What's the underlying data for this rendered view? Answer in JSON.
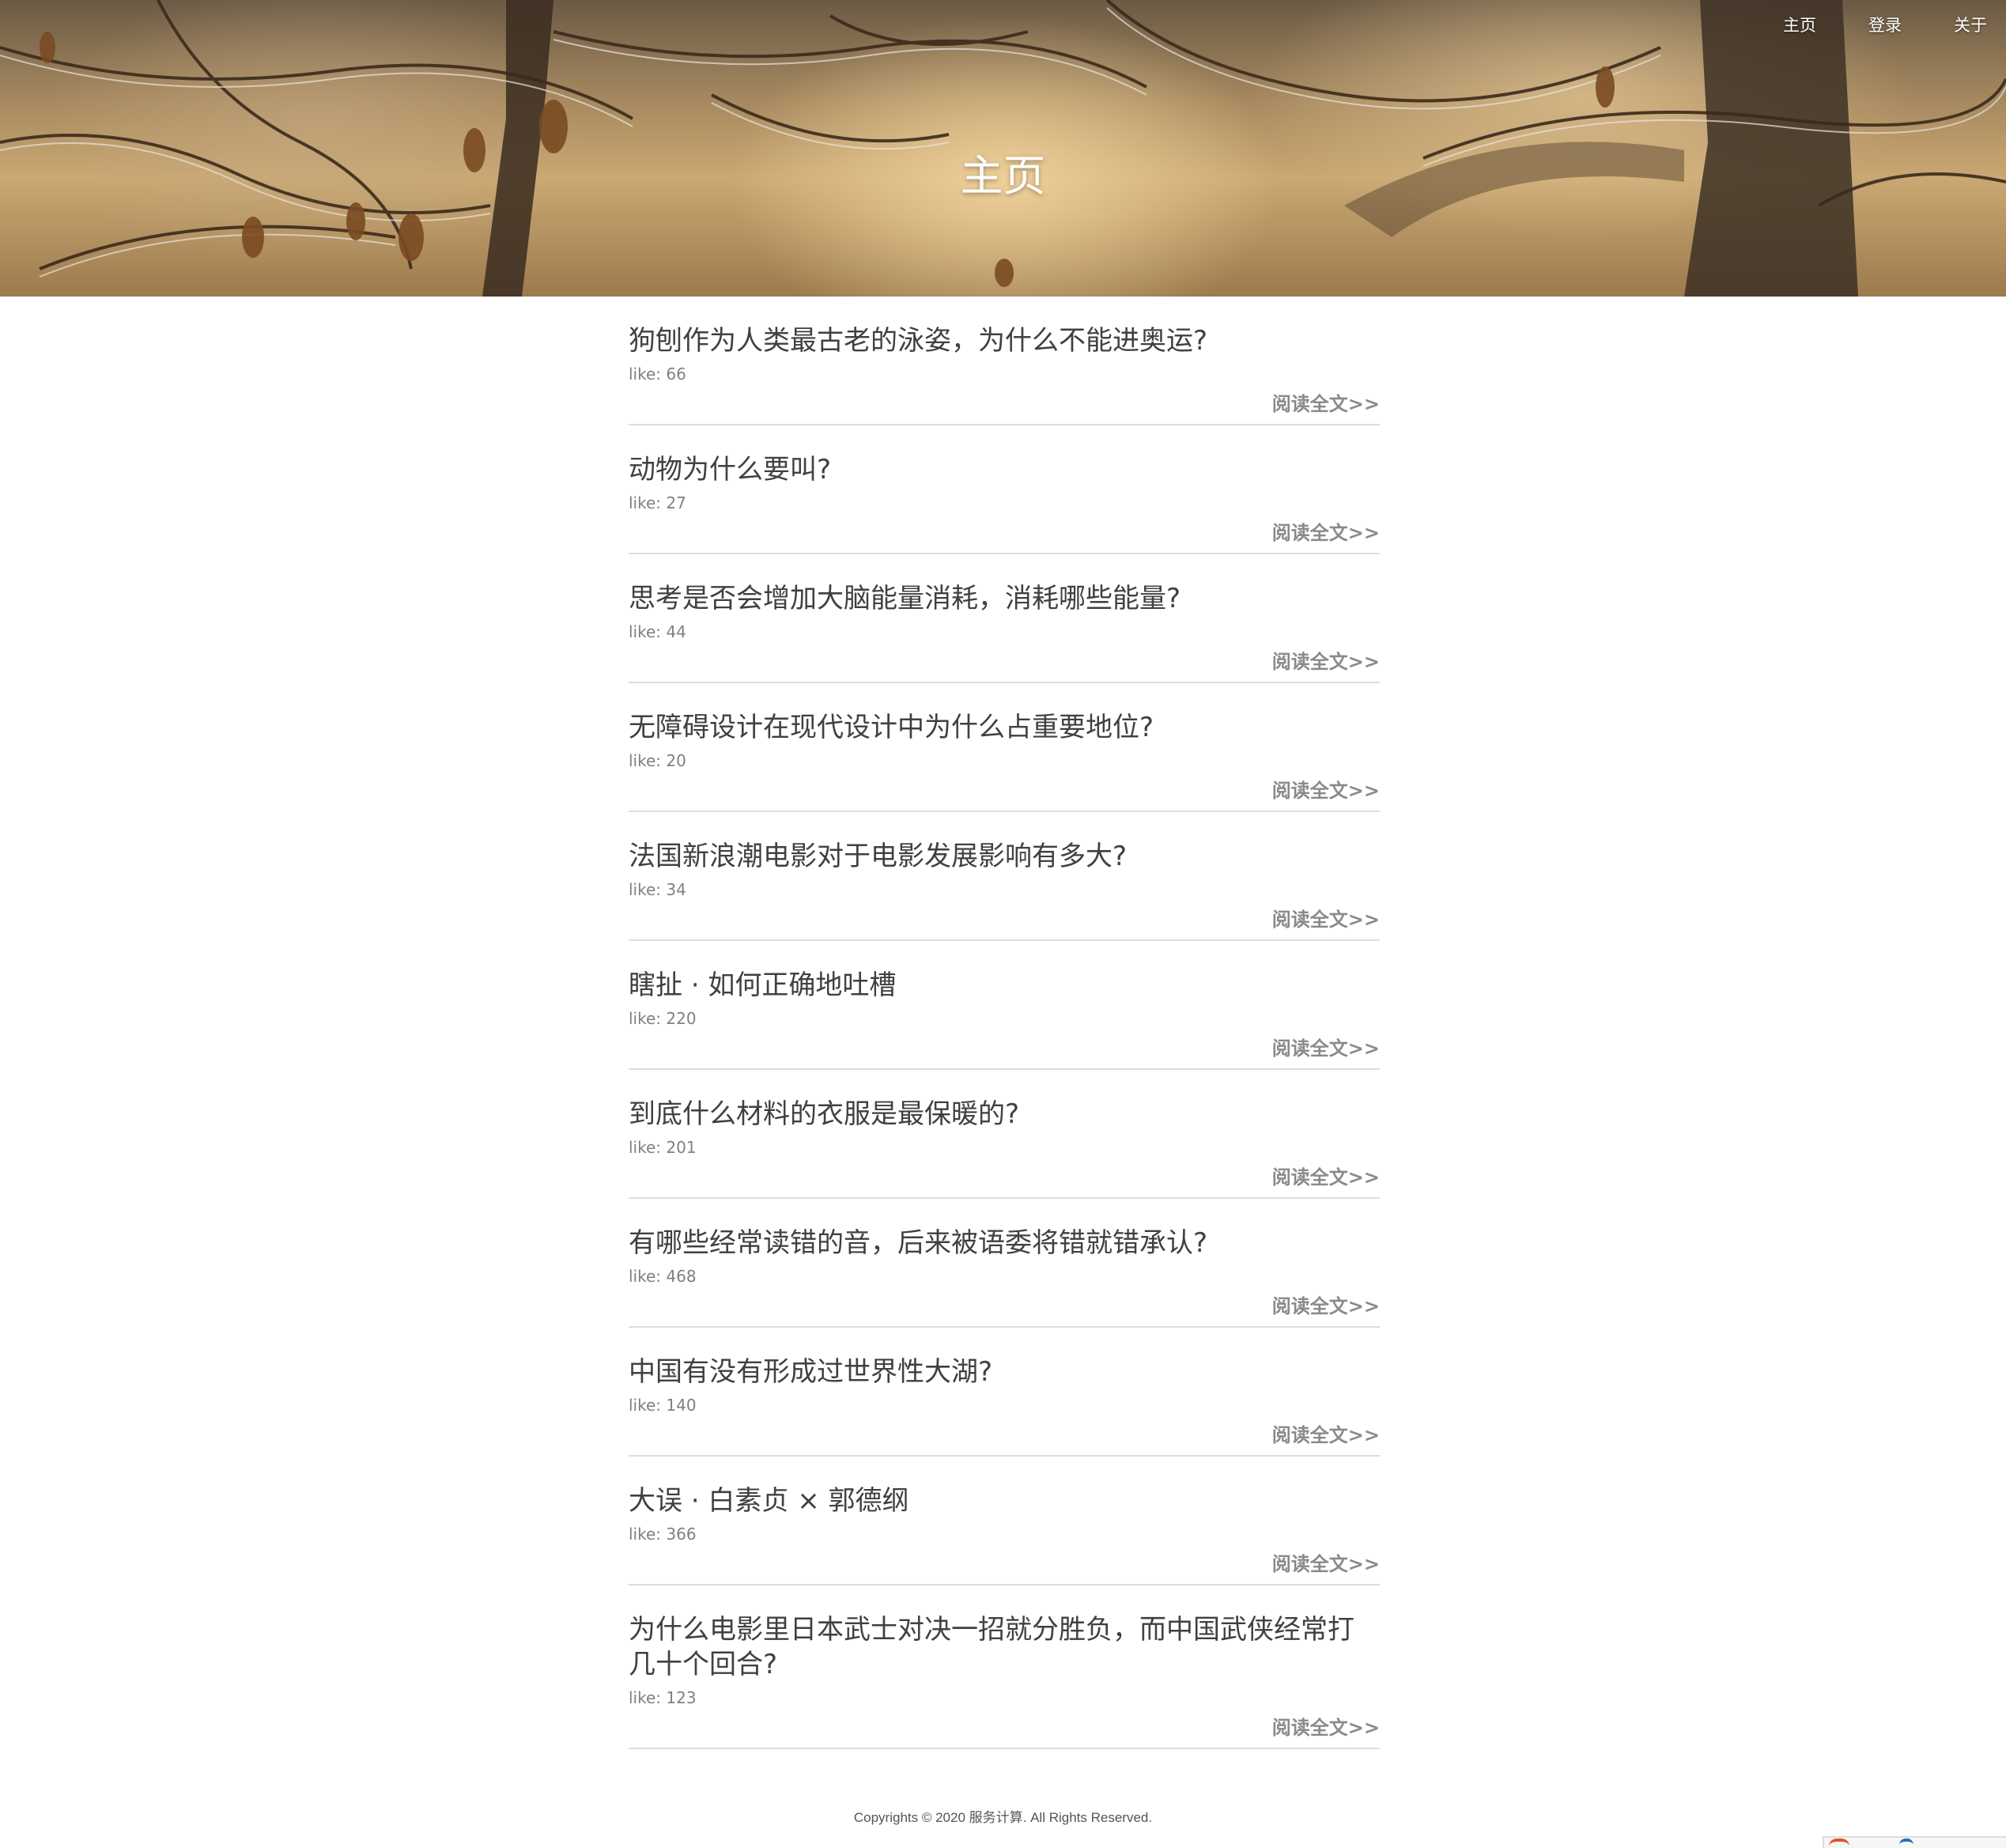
{
  "nav": {
    "items": [
      {
        "label": "主页"
      },
      {
        "label": "登录"
      },
      {
        "label": "关于"
      }
    ]
  },
  "hero": {
    "title": "主页",
    "background": "frosted-branches-photo"
  },
  "posts": [
    {
      "title": "狗刨作为人类最古老的泳姿，为什么不能进奥运?",
      "like": "like: 66",
      "more": "阅读全文>>"
    },
    {
      "title": "动物为什么要叫?",
      "like": "like: 27",
      "more": "阅读全文>>"
    },
    {
      "title": "思考是否会增加大脑能量消耗，消耗哪些能量?",
      "like": "like: 44",
      "more": "阅读全文>>"
    },
    {
      "title": "无障碍设计在现代设计中为什么占重要地位?",
      "like": "like: 20",
      "more": "阅读全文>>"
    },
    {
      "title": "法国新浪潮电影对于电影发展影响有多大?",
      "like": "like: 34",
      "more": "阅读全文>>"
    },
    {
      "title": "瞎扯 · 如何正确地吐槽",
      "like": "like: 220",
      "more": "阅读全文>>"
    },
    {
      "title": "到底什么材料的衣服是最保暖的?",
      "like": "like: 201",
      "more": "阅读全文>>"
    },
    {
      "title": "有哪些经常读错的音，后来被语委将错就错承认?",
      "like": "like: 468",
      "more": "阅读全文>>"
    },
    {
      "title": "中国有没有形成过世界性大湖?",
      "like": "like: 140",
      "more": "阅读全文>>"
    },
    {
      "title": "大误 · 白素贞 × 郭德纲",
      "like": "like: 366",
      "more": "阅读全文>>"
    },
    {
      "title": "为什么电影里日本武士对决一招就分胜负，而中国武侠经常打几十个回合?",
      "like": "like: 123",
      "more": "阅读全文>>"
    }
  ],
  "footer": {
    "text": "Copyrights © 2020 服务计算. All Rights Reserved."
  },
  "colors": {
    "title": "#404040",
    "meta": "#808080",
    "more": "#8a8a8a",
    "divider": "#dddddd"
  }
}
